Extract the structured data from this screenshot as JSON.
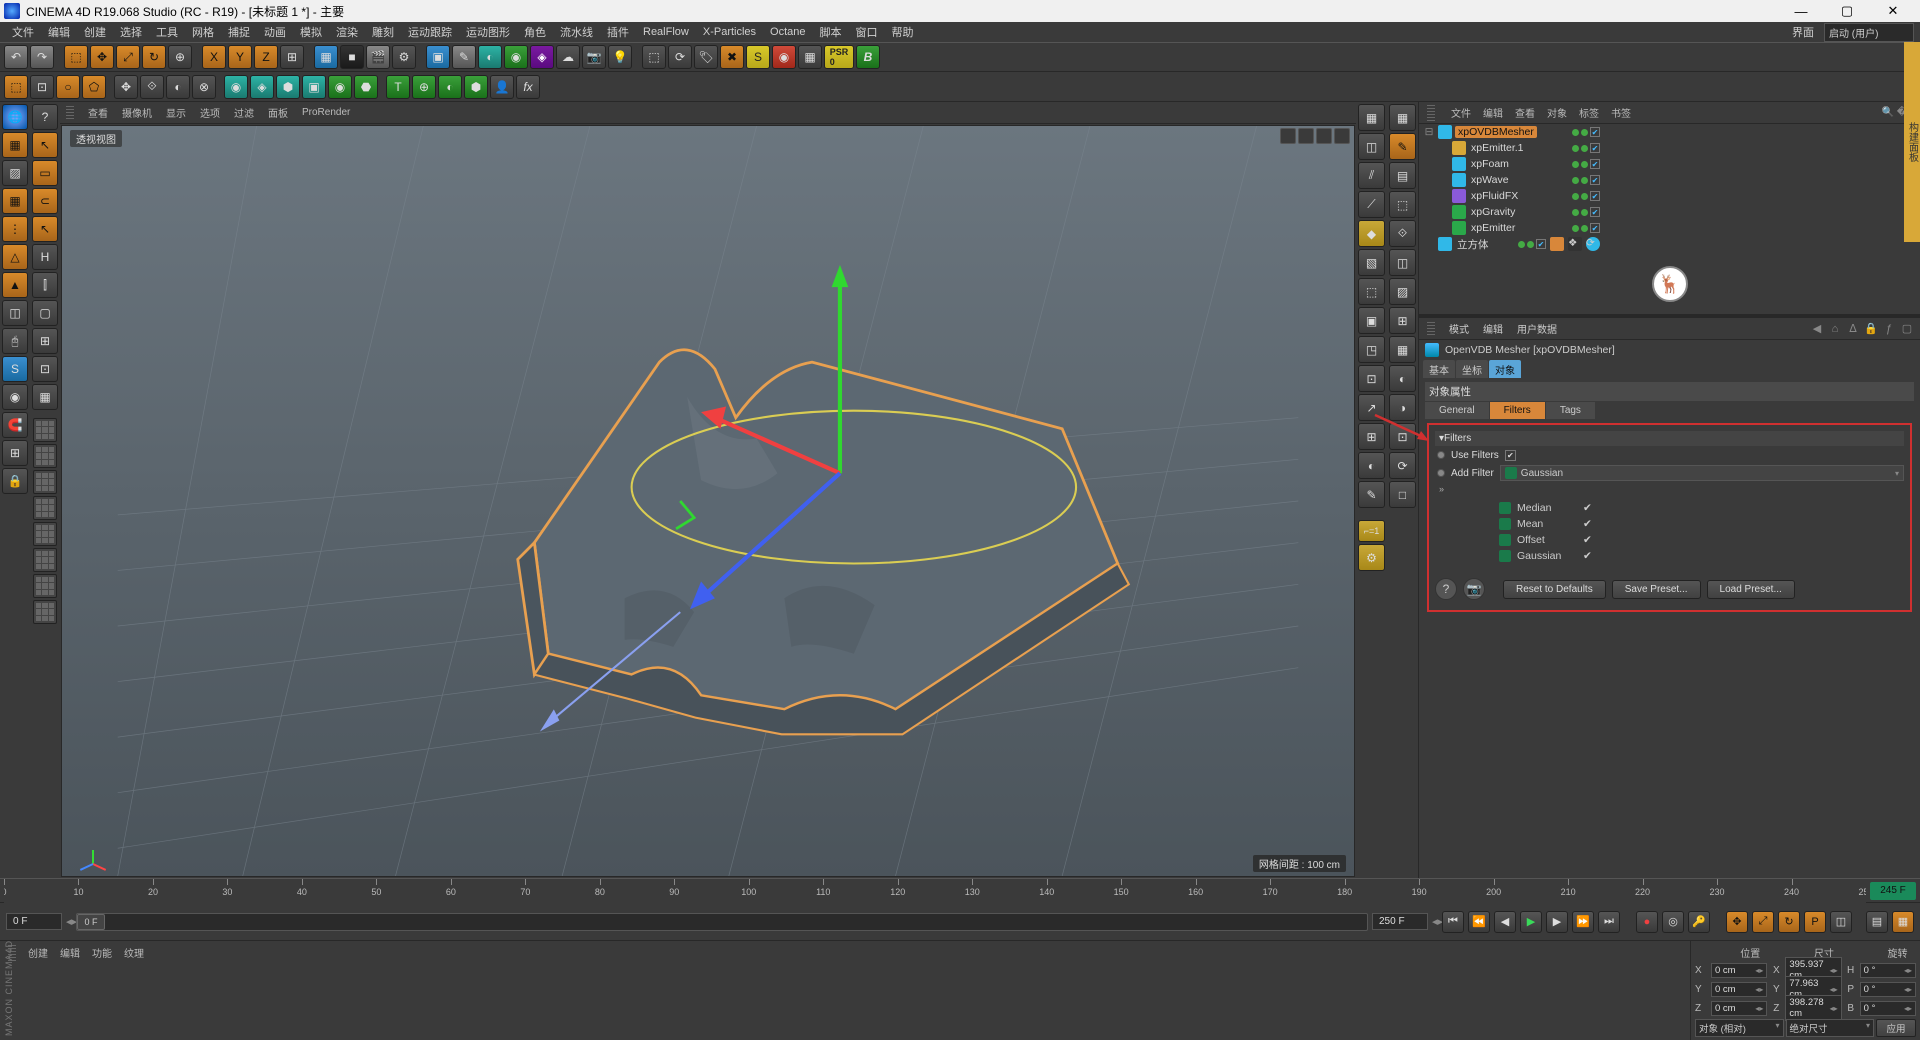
{
  "title": "CINEMA 4D R19.068 Studio (RC - R19) - [未标题 1 *] - 主要",
  "menu": [
    "文件",
    "编辑",
    "创建",
    "选择",
    "工具",
    "网格",
    "捕捉",
    "动画",
    "模拟",
    "渲染",
    "雕刻",
    "运动跟踪",
    "运动图形",
    "角色",
    "流水线",
    "插件",
    "RealFlow",
    "X-Particles",
    "Octane",
    "脚本",
    "窗口",
    "帮助"
  ],
  "layoutLabel": "界面",
  "layoutValue": "启动 (用户)",
  "vpTabs": [
    "查看",
    "摄像机",
    "显示",
    "选项",
    "过滤",
    "面板",
    "ProRender"
  ],
  "vpLabel": "透视视图",
  "gridInfo": "网格间距 : 100 cm",
  "rpTop": [
    "文件",
    "编辑",
    "查看",
    "对象",
    "标签",
    "书签"
  ],
  "tree": [
    {
      "name": "xpOVDBMesher",
      "sel": true,
      "icon": "#30b8e8",
      "indent": 0
    },
    {
      "name": "xpEmitter.1",
      "icon": "#d8a838",
      "indent": 1
    },
    {
      "name": "xpFoam",
      "icon": "#30b8e8",
      "indent": 1
    },
    {
      "name": "xpWave",
      "icon": "#30b8e8",
      "indent": 1
    },
    {
      "name": "xpFluidFX",
      "icon": "#8a5ad8",
      "indent": 1
    },
    {
      "name": "xpGravity",
      "icon": "#2aa84a",
      "indent": 1
    },
    {
      "name": "xpEmitter",
      "icon": "#2aa84a",
      "indent": 1
    },
    {
      "name": "立方体",
      "icon": "#30b8e8",
      "indent": 0,
      "extra": true
    }
  ],
  "attrTabs": [
    "模式",
    "编辑",
    "用户数据"
  ],
  "attrTitle": "OpenVDB Mesher [xpOVDBMesher]",
  "subtabs": [
    "基本",
    "坐标",
    "对象"
  ],
  "sectionHead": "对象属性",
  "tabs2": [
    "General",
    "Filters",
    "Tags"
  ],
  "filtersHead": "▾Filters",
  "useFilters": "Use Filters",
  "addFilter": "Add Filter",
  "addFilterValue": "Gaussian",
  "filterList": [
    {
      "name": "Median",
      "on": true
    },
    {
      "name": "Mean",
      "on": true
    },
    {
      "name": "Offset",
      "on": true
    },
    {
      "name": "Gaussian",
      "on": true
    }
  ],
  "btnReset": "Reset to Defaults",
  "btnSave": "Save Preset...",
  "btnLoad": "Load Preset...",
  "timeline": {
    "start": 0,
    "end": 250,
    "endLabel": "245 F"
  },
  "transport": {
    "cur": "0 F",
    "curSlider": "0 F",
    "end": "250 F"
  },
  "btTabs": [
    "创建",
    "编辑",
    "功能",
    "纹理"
  ],
  "version": "MAXON CINEMA4D",
  "coordHdr": [
    "位置",
    "尺寸",
    "旋转"
  ],
  "coord": {
    "X": {
      "p": "0 cm",
      "s": "395.937 cm",
      "r": "0 °"
    },
    "Y": {
      "p": "0 cm",
      "s": "77.963 cm",
      "r": "0 °"
    },
    "Z": {
      "p": "0 cm",
      "s": "398.278 cm",
      "r": "0 °"
    }
  },
  "coordSel1": "对象 (相对)",
  "coordSel2": "绝对尺寸",
  "coordApply": "应用",
  "sideStrip": "构建面板"
}
